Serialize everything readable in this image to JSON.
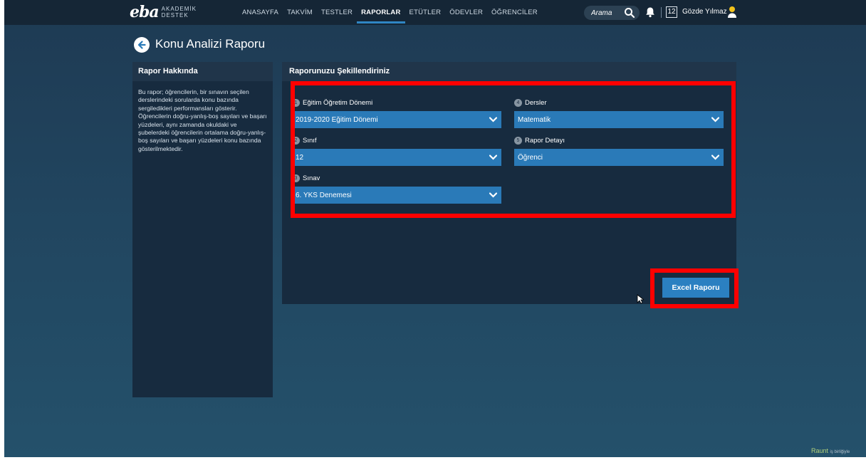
{
  "logo": {
    "main": "eba",
    "sub_line1": "AKADEMİK",
    "sub_line2": "DESTEK"
  },
  "nav": {
    "items": [
      {
        "label": "ANASAYFA",
        "active": false
      },
      {
        "label": "TAKVİM",
        "active": false
      },
      {
        "label": "TESTLER",
        "active": false
      },
      {
        "label": "RAPORLAR",
        "active": true
      },
      {
        "label": "ETÜTLER",
        "active": false
      },
      {
        "label": "ÖDEVLER",
        "active": false
      },
      {
        "label": "ÖĞRENCİLER",
        "active": false
      }
    ],
    "search_placeholder": "Arama",
    "calendar_day": "12",
    "user_name": "Gözde Yılmaz",
    "active_color": "#2f86c4"
  },
  "page": {
    "title": "Konu Analizi Raporu"
  },
  "about": {
    "title": "Rapor Hakkında",
    "text": "Bu rapor; öğrencilerin, bir sınavın seçilen derslerindeki sorularda konu bazında sergiledikleri performansları gösterir. Öğrencilerin doğru-yanlış-boş sayıları ve başarı yüzdeleri, aynı zamanda okuldaki ve şubelerdeki öğrencilerin ortalama doğru-yanlış-boş sayıları ve başarı yüzdeleri konu bazında gösterilmektedir."
  },
  "form": {
    "title": "Raporunuzu Şekillendiriniz",
    "fields": [
      {
        "step": "1",
        "label": "Eğitim Öğretim Dönemi",
        "value": "2019-2020 Eğitim Dönemi"
      },
      {
        "step": "2",
        "label": "Sınıf",
        "value": "12"
      },
      {
        "step": "3",
        "label": "Sınav",
        "value": "6. YKS Denemesi"
      },
      {
        "step": "4",
        "label": "Dersler",
        "value": "Matematik"
      },
      {
        "step": "5",
        "label": "Rapor Detayı",
        "value": "Öğrenci"
      }
    ],
    "excel_button": "Excel Raporu"
  },
  "colors": {
    "accent": "#2a7ab8",
    "button": "#2b80c1",
    "highlight": "#ff0000",
    "panel": "#172b3f"
  },
  "watermark": {
    "brand": "Raunt",
    "suffix": "iş birliğiyle"
  }
}
